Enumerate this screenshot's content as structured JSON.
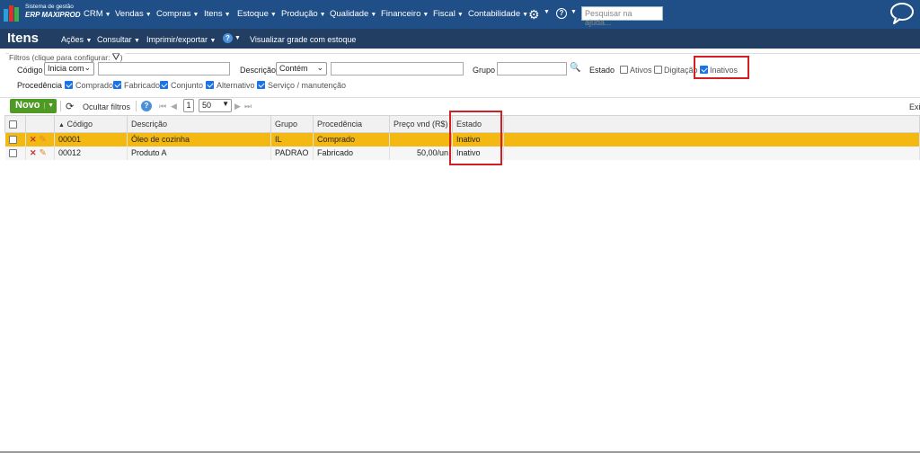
{
  "brand": {
    "line1": "Sistema de gestão",
    "line2": "ERP MAXIPROD"
  },
  "nav": [
    "CRM",
    "Vendas",
    "Compras",
    "Itens",
    "Estoque",
    "Produção",
    "Qualidade",
    "Financeiro",
    "Fiscal",
    "Contabilidade"
  ],
  "help_search": {
    "placeholder": "Pesquisar na ajuda..."
  },
  "page": {
    "title": "Itens",
    "menu": [
      "Ações",
      "Consultar",
      "Imprimir/exportar"
    ],
    "grid_link": "Visualizar grade com estoque"
  },
  "filters": {
    "legend": "Filtros (clique para configurar:",
    "codigo_label": "Código",
    "codigo_mode": "Inicia com",
    "descricao_label": "Descrição",
    "descricao_mode": "Contém",
    "grupo_label": "Grupo",
    "estado_label": "Estado",
    "estado_options": [
      {
        "label": "Ativos",
        "checked": false
      },
      {
        "label": "Digitação",
        "checked": false
      },
      {
        "label": "Inativos",
        "checked": true
      }
    ],
    "procedencia_label": "Procedência",
    "procedencia_options": [
      {
        "label": "Comprado",
        "checked": true
      },
      {
        "label": "Fabricado",
        "checked": true
      },
      {
        "label": "Conjunto",
        "checked": true
      },
      {
        "label": "Alternativo",
        "checked": true
      },
      {
        "label": "Serviço / manutenção",
        "checked": true
      }
    ]
  },
  "toolbar": {
    "novo": "Novo",
    "hide_filters": "Ocultar filtros",
    "page": "1",
    "page_size": "50",
    "export_cut": "Exi"
  },
  "grid": {
    "columns": [
      "Código",
      "Descrição",
      "Grupo",
      "Procedência",
      "Preço vnd (R$)",
      "Estado"
    ],
    "rows": [
      {
        "codigo": "00001",
        "descricao": "Óleo de cozinha",
        "grupo": "IL",
        "procedencia": "Comprado",
        "preco": "",
        "estado": "Inativo",
        "selected": true
      },
      {
        "codigo": "00012",
        "descricao": "Produto A",
        "grupo": "PADRAO",
        "procedencia": "Fabricado",
        "preco": "50,00/un",
        "estado": "Inativo",
        "selected": false
      }
    ]
  },
  "colors": {
    "topbar": "#1f4f86",
    "pagebar": "#223e63",
    "selected_row": "#f4b813",
    "novo_button": "#4e9a24",
    "highlight_box": "#d21f25"
  }
}
